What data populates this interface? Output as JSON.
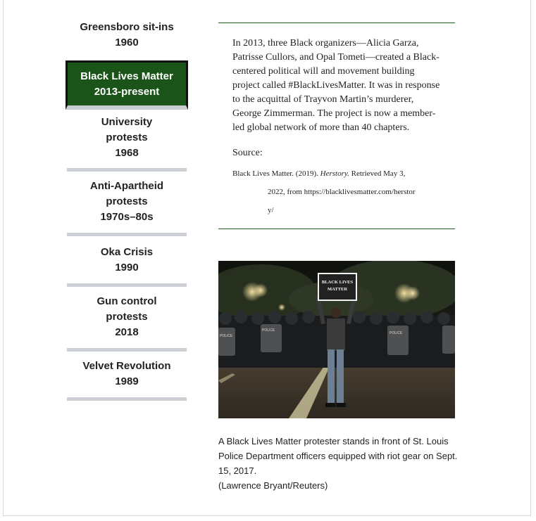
{
  "sidebar": {
    "items": [
      {
        "title": "Greensboro sit-ins",
        "period": "1960",
        "active": false
      },
      {
        "title": "Black Lives Matter",
        "period": "2013-present",
        "active": true
      },
      {
        "title": "University protests",
        "period": "1968",
        "active": false
      },
      {
        "title": "Anti-Apartheid protests",
        "period": "1970s–80s",
        "active": false
      },
      {
        "title": "Oka Crisis",
        "period": "1990",
        "active": false
      },
      {
        "title": "Gun control protests",
        "period": "2018",
        "active": false
      },
      {
        "title": "Velvet Revolution",
        "period": "1989",
        "active": false
      }
    ]
  },
  "article": {
    "body": "In 2013, three Black organizers—Alicia Garza, Patrisse Cullors, and Opal Tometi—created a Black-centered political will and movement building project called #BlackLivesMatter. It was in response to the acquittal of Trayvon Martin’s murderer, George Zimmerman. The project is now a member-led global network of more than 40 chapters.",
    "source_label": "Source:",
    "citation_author": "Black Lives Matter. (2019).",
    "citation_title": "Herstory.",
    "citation_retrieved": "Retrieved May 3,",
    "citation_line2": "2022, from https://blacklivesmatter.com/herstor",
    "citation_line3": "y/"
  },
  "photo": {
    "sign_text_line1": "BLACK LIVES",
    "sign_text_line2": "MATTER",
    "shield_text": "POLICE",
    "caption": "A Black Lives Matter protester stands in front of St. Louis Police Department officers equipped with riot gear on Sept. 15, 2017.",
    "credit": "(Lawrence Bryant/Reuters)"
  },
  "colors": {
    "accent": "#1b5419",
    "divider": "#ccd0d4"
  }
}
